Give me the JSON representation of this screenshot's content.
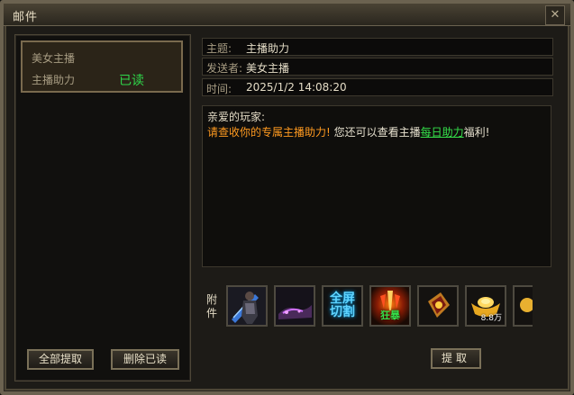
{
  "window": {
    "title": "邮件"
  },
  "mail_list": [
    {
      "sender": "美女主播",
      "subject": "主播助力",
      "status": "已读",
      "status_color": "#2fd64a"
    }
  ],
  "left_buttons": {
    "collect_all": "全部提取",
    "delete_read": "删除已读"
  },
  "mail": {
    "subject_label": "主题:",
    "subject": "主播助力",
    "sender_label": "发送者:",
    "sender": "美女主播",
    "time_label": "时间:",
    "time": "2025/1/2 14:08:20",
    "greeting": "亲爱的玩家:",
    "body_orange": "请查收你的专属主播助力!",
    "body_white": " 您还可以查看主播",
    "body_link": "每日助力",
    "body_tail": "福利!"
  },
  "attachments": {
    "label": "附件",
    "items": [
      {
        "icon": "warrior-armor-icon"
      },
      {
        "icon": "purple-mount-icon"
      },
      {
        "icon": "fullscreen-cut-skill-icon",
        "text": "全屏\n切割"
      },
      {
        "icon": "berserk-skill-icon",
        "text": "狂暴"
      },
      {
        "icon": "golden-rune-icon"
      },
      {
        "icon": "gold-ingot-icon",
        "count": "8.8万"
      },
      {
        "icon": "gold-item-icon"
      }
    ]
  },
  "claim_button": "提取",
  "colors": {
    "accent_orange": "#ff9a20",
    "link_green": "#35e04a",
    "status_green": "#2fd64a"
  }
}
